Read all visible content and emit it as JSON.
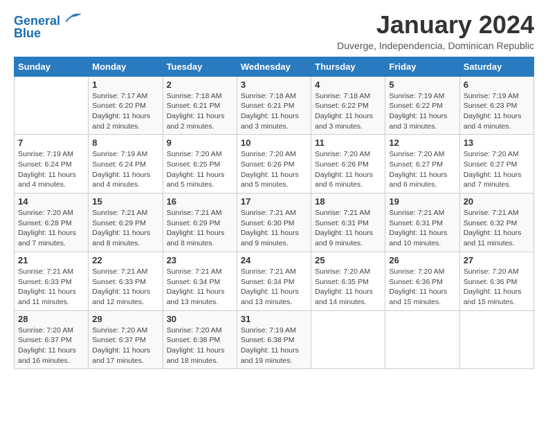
{
  "logo": {
    "line1": "General",
    "line2": "Blue"
  },
  "title": "January 2024",
  "subtitle": "Duverge, Independencia, Dominican Republic",
  "days_of_week": [
    "Sunday",
    "Monday",
    "Tuesday",
    "Wednesday",
    "Thursday",
    "Friday",
    "Saturday"
  ],
  "weeks": [
    [
      {
        "day": "",
        "info": ""
      },
      {
        "day": "1",
        "info": "Sunrise: 7:17 AM\nSunset: 6:20 PM\nDaylight: 11 hours and 2 minutes."
      },
      {
        "day": "2",
        "info": "Sunrise: 7:18 AM\nSunset: 6:21 PM\nDaylight: 11 hours and 2 minutes."
      },
      {
        "day": "3",
        "info": "Sunrise: 7:18 AM\nSunset: 6:21 PM\nDaylight: 11 hours and 3 minutes."
      },
      {
        "day": "4",
        "info": "Sunrise: 7:18 AM\nSunset: 6:22 PM\nDaylight: 11 hours and 3 minutes."
      },
      {
        "day": "5",
        "info": "Sunrise: 7:19 AM\nSunset: 6:22 PM\nDaylight: 11 hours and 3 minutes."
      },
      {
        "day": "6",
        "info": "Sunrise: 7:19 AM\nSunset: 6:23 PM\nDaylight: 11 hours and 4 minutes."
      }
    ],
    [
      {
        "day": "7",
        "info": "Sunrise: 7:19 AM\nSunset: 6:24 PM\nDaylight: 11 hours and 4 minutes."
      },
      {
        "day": "8",
        "info": "Sunrise: 7:19 AM\nSunset: 6:24 PM\nDaylight: 11 hours and 4 minutes."
      },
      {
        "day": "9",
        "info": "Sunrise: 7:20 AM\nSunset: 6:25 PM\nDaylight: 11 hours and 5 minutes."
      },
      {
        "day": "10",
        "info": "Sunrise: 7:20 AM\nSunset: 6:26 PM\nDaylight: 11 hours and 5 minutes."
      },
      {
        "day": "11",
        "info": "Sunrise: 7:20 AM\nSunset: 6:26 PM\nDaylight: 11 hours and 6 minutes."
      },
      {
        "day": "12",
        "info": "Sunrise: 7:20 AM\nSunset: 6:27 PM\nDaylight: 11 hours and 6 minutes."
      },
      {
        "day": "13",
        "info": "Sunrise: 7:20 AM\nSunset: 6:27 PM\nDaylight: 11 hours and 7 minutes."
      }
    ],
    [
      {
        "day": "14",
        "info": "Sunrise: 7:20 AM\nSunset: 6:28 PM\nDaylight: 11 hours and 7 minutes."
      },
      {
        "day": "15",
        "info": "Sunrise: 7:21 AM\nSunset: 6:29 PM\nDaylight: 11 hours and 8 minutes."
      },
      {
        "day": "16",
        "info": "Sunrise: 7:21 AM\nSunset: 6:29 PM\nDaylight: 11 hours and 8 minutes."
      },
      {
        "day": "17",
        "info": "Sunrise: 7:21 AM\nSunset: 6:30 PM\nDaylight: 11 hours and 9 minutes."
      },
      {
        "day": "18",
        "info": "Sunrise: 7:21 AM\nSunset: 6:31 PM\nDaylight: 11 hours and 9 minutes."
      },
      {
        "day": "19",
        "info": "Sunrise: 7:21 AM\nSunset: 6:31 PM\nDaylight: 11 hours and 10 minutes."
      },
      {
        "day": "20",
        "info": "Sunrise: 7:21 AM\nSunset: 6:32 PM\nDaylight: 11 hours and 11 minutes."
      }
    ],
    [
      {
        "day": "21",
        "info": "Sunrise: 7:21 AM\nSunset: 6:33 PM\nDaylight: 11 hours and 11 minutes."
      },
      {
        "day": "22",
        "info": "Sunrise: 7:21 AM\nSunset: 6:33 PM\nDaylight: 11 hours and 12 minutes."
      },
      {
        "day": "23",
        "info": "Sunrise: 7:21 AM\nSunset: 6:34 PM\nDaylight: 11 hours and 13 minutes."
      },
      {
        "day": "24",
        "info": "Sunrise: 7:21 AM\nSunset: 6:34 PM\nDaylight: 11 hours and 13 minutes."
      },
      {
        "day": "25",
        "info": "Sunrise: 7:20 AM\nSunset: 6:35 PM\nDaylight: 11 hours and 14 minutes."
      },
      {
        "day": "26",
        "info": "Sunrise: 7:20 AM\nSunset: 6:36 PM\nDaylight: 11 hours and 15 minutes."
      },
      {
        "day": "27",
        "info": "Sunrise: 7:20 AM\nSunset: 6:36 PM\nDaylight: 11 hours and 15 minutes."
      }
    ],
    [
      {
        "day": "28",
        "info": "Sunrise: 7:20 AM\nSunset: 6:37 PM\nDaylight: 11 hours and 16 minutes."
      },
      {
        "day": "29",
        "info": "Sunrise: 7:20 AM\nSunset: 6:37 PM\nDaylight: 11 hours and 17 minutes."
      },
      {
        "day": "30",
        "info": "Sunrise: 7:20 AM\nSunset: 6:38 PM\nDaylight: 11 hours and 18 minutes."
      },
      {
        "day": "31",
        "info": "Sunrise: 7:19 AM\nSunset: 6:38 PM\nDaylight: 11 hours and 19 minutes."
      },
      {
        "day": "",
        "info": ""
      },
      {
        "day": "",
        "info": ""
      },
      {
        "day": "",
        "info": ""
      }
    ]
  ]
}
